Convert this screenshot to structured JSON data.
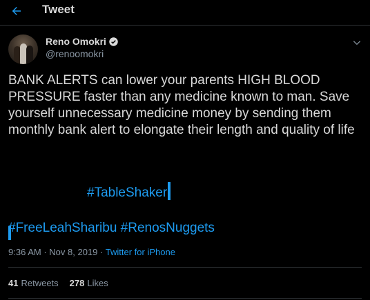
{
  "header": {
    "title": "Tweet"
  },
  "author": {
    "name": "Reno Omokri",
    "handle": "@renoomokri"
  },
  "tweet": {
    "text": "BANK ALERTS can lower your parents HIGH BLOOD PRESSURE faster than any medicine known to man. Save yourself unnecessary medicine money by sending them monthly bank alert to elongate their length and quality of life",
    "hashtags": [
      "#TableShaker",
      "#FreeLeahSharibu",
      "#RenosNuggets"
    ]
  },
  "meta": {
    "time": "9:36 AM",
    "date": "Nov 8, 2019",
    "source": "Twitter for iPhone",
    "separator": "·"
  },
  "stats": {
    "retweets_count": "41",
    "retweets_label": "Retweets",
    "likes_count": "278",
    "likes_label": "Likes"
  },
  "colors": {
    "background": "#000000",
    "accent": "#1d9bf0",
    "text": "#d9d9d9",
    "muted": "#8b98a5"
  },
  "icons": {
    "back": "arrow-left-icon",
    "verified": "verified-badge-icon",
    "more": "chevron-down-icon"
  }
}
